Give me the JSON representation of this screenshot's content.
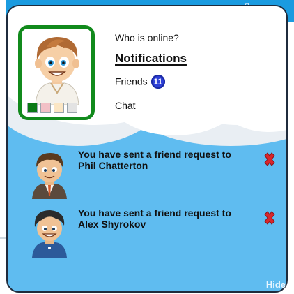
{
  "top_strip_text": "g",
  "profile": {
    "swatch_colors": [
      "#0a7a15",
      "#f2c0c6",
      "#fbe6c4",
      "#e3e3e3"
    ]
  },
  "menu": {
    "who_online": "Who is online?",
    "notifications": "Notifications",
    "friends": "Friends",
    "friends_count": "11",
    "chat": "Chat"
  },
  "notifications": [
    {
      "text": "You have sent a friend request to Phil Chatterton",
      "avatar_icon": "businessman-avatar-icon",
      "close_icon": "close-x-icon"
    },
    {
      "text": "You have sent a friend request to Alex Shyrokov",
      "avatar_icon": "boy-avatar-icon",
      "close_icon": "close-x-icon"
    }
  ],
  "hide_label": "Hide",
  "colors": {
    "panel_bg": "#5fbcf0",
    "profile_border": "#118a1c",
    "badge": "#2d3fd6",
    "close_x": "#d9262b"
  }
}
